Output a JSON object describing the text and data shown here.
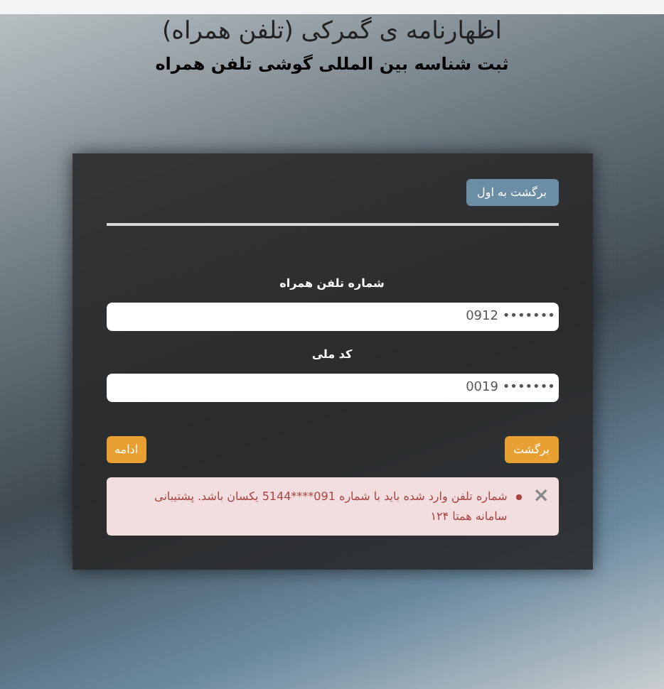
{
  "header": {
    "title": "اظهارنامه ی گمرکی (تلفن همراه)",
    "subtitle": "ثبت شناسه بین المللی گوشی تلفن همراه"
  },
  "panel": {
    "back_to_start": "برگشت به اول",
    "fields": [
      {
        "label": "شماره تلفن همراه",
        "value": "0912 •••••••"
      },
      {
        "label": "کد ملی",
        "value": "0019 •••••••"
      }
    ],
    "buttons": {
      "continue": "ادامه",
      "back": "برگشت"
    },
    "alert": {
      "close": "×",
      "messages": [
        "شماره تلفن وارد شده باید با شماره 091****5144 یکسان باشد. پشتیبانی سامانه همتا ۱۲۴"
      ]
    }
  }
}
